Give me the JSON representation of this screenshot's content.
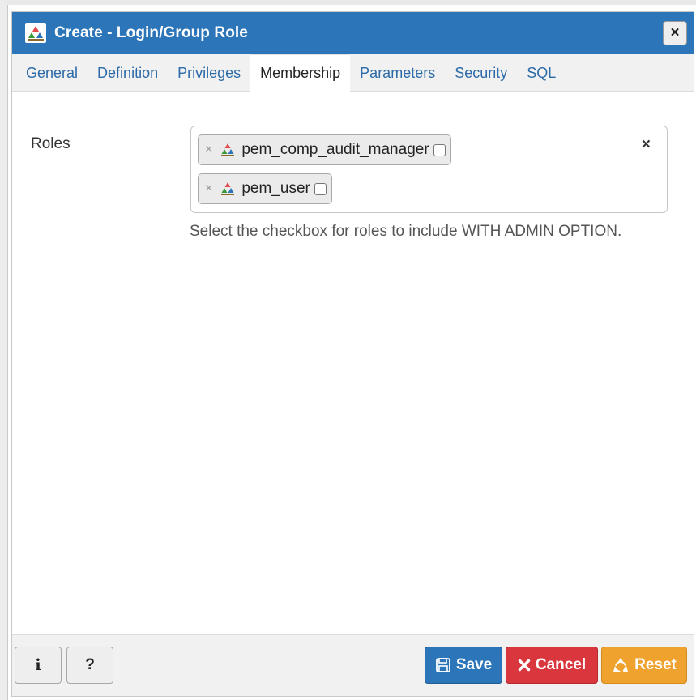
{
  "dialog": {
    "title": "Create - Login/Group Role",
    "close_label": "×",
    "icons": {
      "title": "role-group-icon",
      "close": "close-icon"
    }
  },
  "tabs": [
    {
      "label": "General",
      "active": false
    },
    {
      "label": "Definition",
      "active": false
    },
    {
      "label": "Privileges",
      "active": false
    },
    {
      "label": "Membership",
      "active": true
    },
    {
      "label": "Parameters",
      "active": false
    },
    {
      "label": "Security",
      "active": false
    },
    {
      "label": "SQL",
      "active": false
    }
  ],
  "membership": {
    "roles_label": "Roles",
    "selected_roles": [
      {
        "name": "pem_comp_audit_manager",
        "with_admin": false,
        "remove_label": "×",
        "icon": "role-group-icon"
      },
      {
        "name": "pem_user",
        "with_admin": false,
        "remove_label": "×",
        "icon": "role-group-icon"
      }
    ],
    "clear_label": "×",
    "help_text": "Select the checkbox for roles to include WITH ADMIN OPTION."
  },
  "footer": {
    "info_label": "i",
    "help_label": "?",
    "save_label": "Save",
    "cancel_label": "Cancel",
    "reset_label": "Reset",
    "colors": {
      "primary": "#2c75b8",
      "danger": "#d9363e",
      "warning": "#f0a22e"
    },
    "icons": {
      "save": "floppy-disk-icon",
      "cancel": "x-mark-icon",
      "reset": "recycle-icon"
    }
  }
}
